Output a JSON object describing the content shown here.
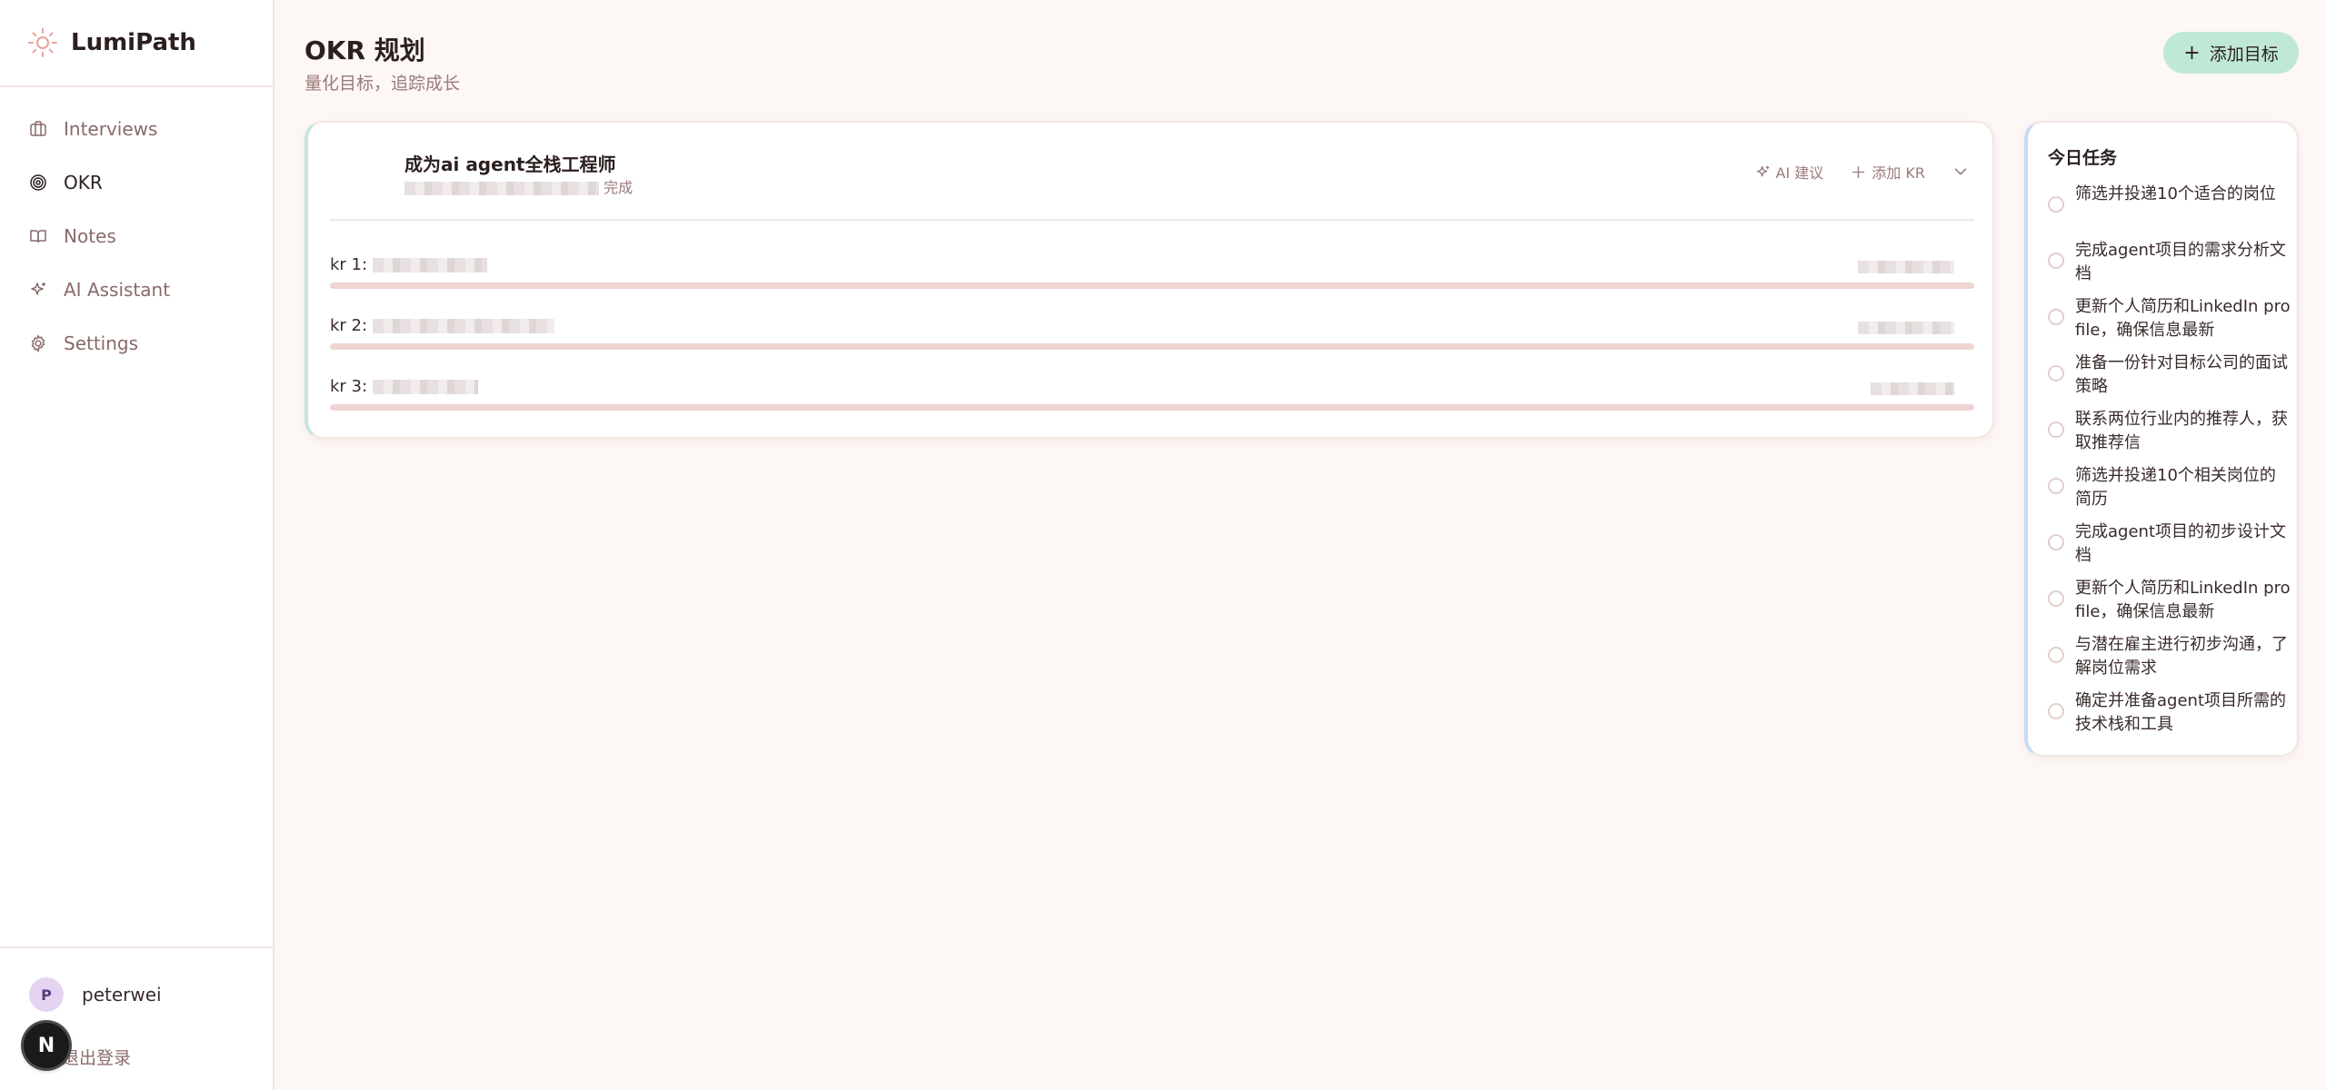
{
  "app": {
    "name": "LumiPath",
    "colors": {
      "accent": "#bfe8d7",
      "bar": "#eed5d3",
      "sidebar_active": "#2c1f1f",
      "okr_border": "#c4e6d4",
      "tasks_border": "#c6daf5"
    }
  },
  "sidebar": {
    "items": [
      {
        "label": "Interviews",
        "icon": "briefcase-icon",
        "active": false
      },
      {
        "label": "OKR",
        "icon": "target-icon",
        "active": true
      },
      {
        "label": "Notes",
        "icon": "book-open-icon",
        "active": false
      },
      {
        "label": "AI Assistant",
        "icon": "sparkles-icon",
        "active": false
      },
      {
        "label": "Settings",
        "icon": "gear-icon",
        "active": false
      }
    ],
    "user": {
      "initial": "P",
      "name": "peterwei"
    },
    "logout_label": "退出登录",
    "devtool_label": "N"
  },
  "header": {
    "title": "OKR 规划",
    "subtitle": "量化目标，追踪成长",
    "add_goal_label": "添加目标"
  },
  "okr": {
    "title": "成为ai agent全栈工程师",
    "meta_suffix": "完成",
    "ai_suggest_label": "AI 建议",
    "add_kr_label": "添加 KR",
    "krs": [
      {
        "label": "kr 1:",
        "progress": 0
      },
      {
        "label": "kr 2:",
        "progress": 0
      },
      {
        "label": "kr 3:",
        "progress": 0
      }
    ]
  },
  "tasks": {
    "title": "今日任务",
    "items": [
      "筛选并投递10个适合的岗位",
      "完成agent项目的需求分析文档",
      "更新个人简历和LinkedIn profile，确保信息最新",
      "准备一份针对目标公司的面试策略",
      "联系两位行业内的推荐人，获取推荐信",
      "筛选并投递10个相关岗位的简历",
      "完成agent项目的初步设计文档",
      "更新个人简历和LinkedIn profile，确保信息最新",
      "与潜在雇主进行初步沟通，了解岗位需求",
      "确定并准备agent项目所需的技术栈和工具"
    ]
  }
}
